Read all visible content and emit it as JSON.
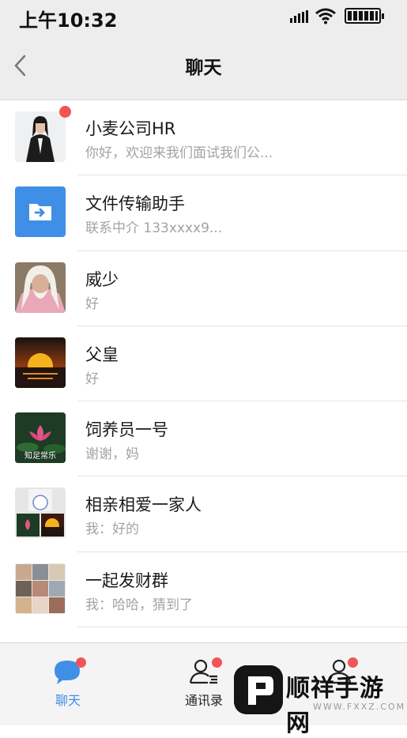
{
  "status_bar": {
    "time": "上午10:32"
  },
  "header": {
    "title": "聊天"
  },
  "chats": [
    {
      "name": "小麦公司HR",
      "message": "你好，欢迎来我们面试我们公...",
      "unread": true
    },
    {
      "name": "文件传输助手",
      "message": "联系中介 133xxxx9...",
      "unread": false
    },
    {
      "name": "威少",
      "message": "好",
      "unread": false
    },
    {
      "name": "父皇",
      "message": "好",
      "unread": false
    },
    {
      "name": "饲养员一号",
      "message": "谢谢，妈",
      "unread": false
    },
    {
      "name": "相亲相爱一家人",
      "message": "我：好的",
      "unread": false
    },
    {
      "name": "一起发财群",
      "message": "我：哈哈，猜到了",
      "unread": false
    }
  ],
  "avatar_captions": {
    "lotus": "知足常乐"
  },
  "tabs": [
    {
      "label": "聊天",
      "active": true,
      "badge": true
    },
    {
      "label": "通讯录",
      "active": false,
      "badge": true
    },
    {
      "label": "",
      "active": false,
      "badge": true
    }
  ],
  "watermark": {
    "text": "顺祥手游网",
    "url": "WWW.FXXZ.COM"
  },
  "colors": {
    "accent": "#3f8fe6",
    "badge": "#f25555",
    "header_bg": "#ededed"
  }
}
